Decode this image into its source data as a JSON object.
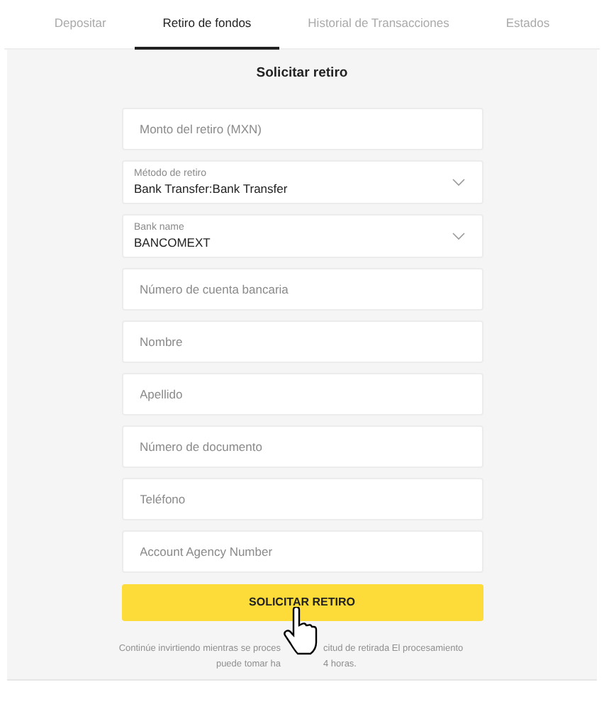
{
  "tabs": [
    {
      "label": "Depositar",
      "selected": false
    },
    {
      "label": "Retiro de fondos",
      "selected": true
    },
    {
      "label": "Historial de Transacciones",
      "selected": false
    },
    {
      "label": "Estados",
      "selected": false
    }
  ],
  "form": {
    "title": "Solicitar retiro",
    "fields": [
      {
        "kind": "input",
        "placeholder": "Monto del retiro (MXN)"
      },
      {
        "kind": "select",
        "label": "Método de retiro",
        "value": "Bank Transfer:Bank Transfer"
      },
      {
        "kind": "select",
        "label": "Bank name",
        "value": "BANCOMEXT"
      },
      {
        "kind": "input",
        "placeholder": "Número de cuenta bancaria"
      },
      {
        "kind": "input",
        "placeholder": "Nombre"
      },
      {
        "kind": "input",
        "placeholder": "Apellido"
      },
      {
        "kind": "input",
        "placeholder": "Número de documento"
      },
      {
        "kind": "input",
        "placeholder": "Teléfono"
      },
      {
        "kind": "input",
        "placeholder": "Account Agency Number"
      }
    ],
    "submit": "SOLICITAR RETIRO",
    "note_lines": [
      [
        "Continúe invirtiendo mientras se proces",
        "citud de retirada  El procesamiento"
      ],
      [
        "puede tomar ha",
        "4 horas."
      ]
    ]
  }
}
